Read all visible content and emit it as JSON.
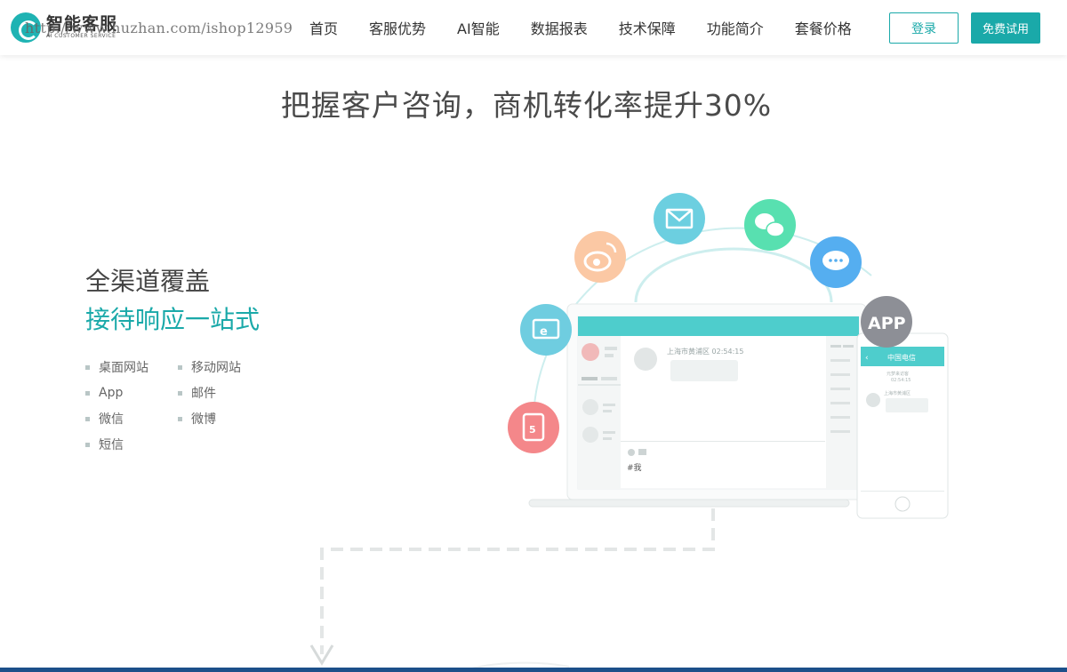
{
  "header": {
    "logo_name": "智能客服",
    "logo_sub": "AI CUSTOMER SERVICE",
    "watermark": "http://www.huzhan.com/ishop12959",
    "nav": [
      "首页",
      "客服优势",
      "AI智能",
      "数据报表",
      "技术保障",
      "功能简介",
      "套餐价格"
    ],
    "login_label": "登录",
    "trial_label": "免费试用"
  },
  "headline": "把握客户咨询，商机转化率提升30%",
  "feature": {
    "title": "全渠道覆盖",
    "subtitle": "接待响应一站式",
    "channels": [
      "桌面网站",
      "移动网站",
      "App",
      "邮件",
      "微信",
      "微博",
      "短信"
    ]
  },
  "illustration": {
    "desktop_location": "上海市黄浦区 02:54:15",
    "desktop_input": "#我",
    "phone_title": "中国电信",
    "phone_meta1": "元梦来访客",
    "phone_meta2": "02:54:15",
    "phone_location": "上海市黄浦区",
    "app_label": "APP",
    "colors": {
      "teal": "#4ecdcc",
      "mail": "#6ccfe0",
      "wechat": "#58e0b0",
      "chat": "#55aef0",
      "weibo": "#fbc8a4",
      "ie": "#6fcde0",
      "html5": "#f4878a",
      "app": "#8d8f96"
    },
    "icons": [
      "weibo-icon",
      "mail-icon",
      "wechat-icon",
      "chat-bubble-icon",
      "ie-icon",
      "html5-icon",
      "app-icon"
    ]
  }
}
